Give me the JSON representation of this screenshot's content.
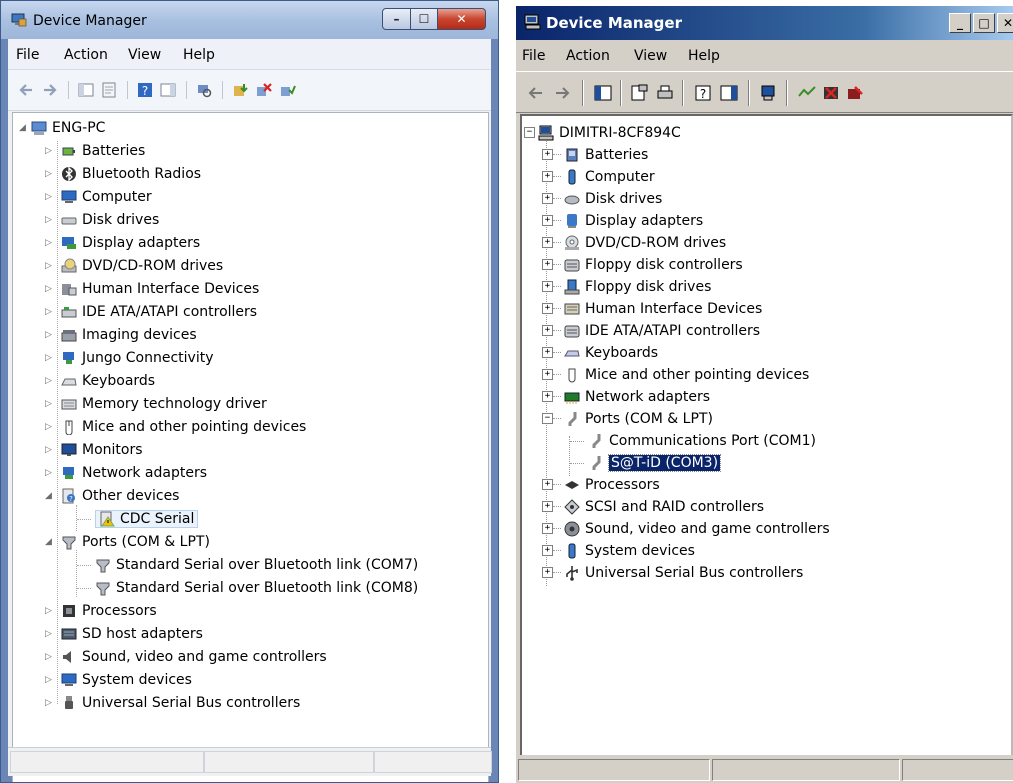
{
  "left": {
    "title": "Device Manager",
    "menu": [
      "File",
      "Action",
      "View",
      "Help"
    ],
    "root": "ENG-PC",
    "items": [
      "Batteries",
      "Bluetooth Radios",
      "Computer",
      "Disk drives",
      "Display adapters",
      "DVD/CD-ROM drives",
      "Human Interface Devices",
      "IDE ATA/ATAPI controllers",
      "Imaging devices",
      "Jungo Connectivity",
      "Keyboards",
      "Memory technology driver",
      "Mice and other pointing devices",
      "Monitors",
      "Network adapters",
      "Other devices",
      "CDC Serial",
      "Ports (COM & LPT)",
      "Standard Serial over Bluetooth link (COM7)",
      "Standard Serial over Bluetooth link (COM8)",
      "Processors",
      "SD host adapters",
      "Sound, video and game controllers",
      "System devices",
      "Universal Serial Bus controllers"
    ]
  },
  "right": {
    "title": "Device Manager",
    "menu": [
      "File",
      "Action",
      "View",
      "Help"
    ],
    "root": "DIMITRI-8CF894C",
    "items": [
      "Batteries",
      "Computer",
      "Disk drives",
      "Display adapters",
      "DVD/CD-ROM drives",
      "Floppy disk controllers",
      "Floppy disk drives",
      "Human Interface Devices",
      "IDE ATA/ATAPI controllers",
      "Keyboards",
      "Mice and other pointing devices",
      "Network adapters",
      "Ports (COM & LPT)",
      "Communications Port (COM1)",
      "S@T-iD (COM3)",
      "Processors",
      "SCSI and RAID controllers",
      "Sound, video and game controllers",
      "System devices",
      "Universal Serial Bus controllers"
    ]
  }
}
